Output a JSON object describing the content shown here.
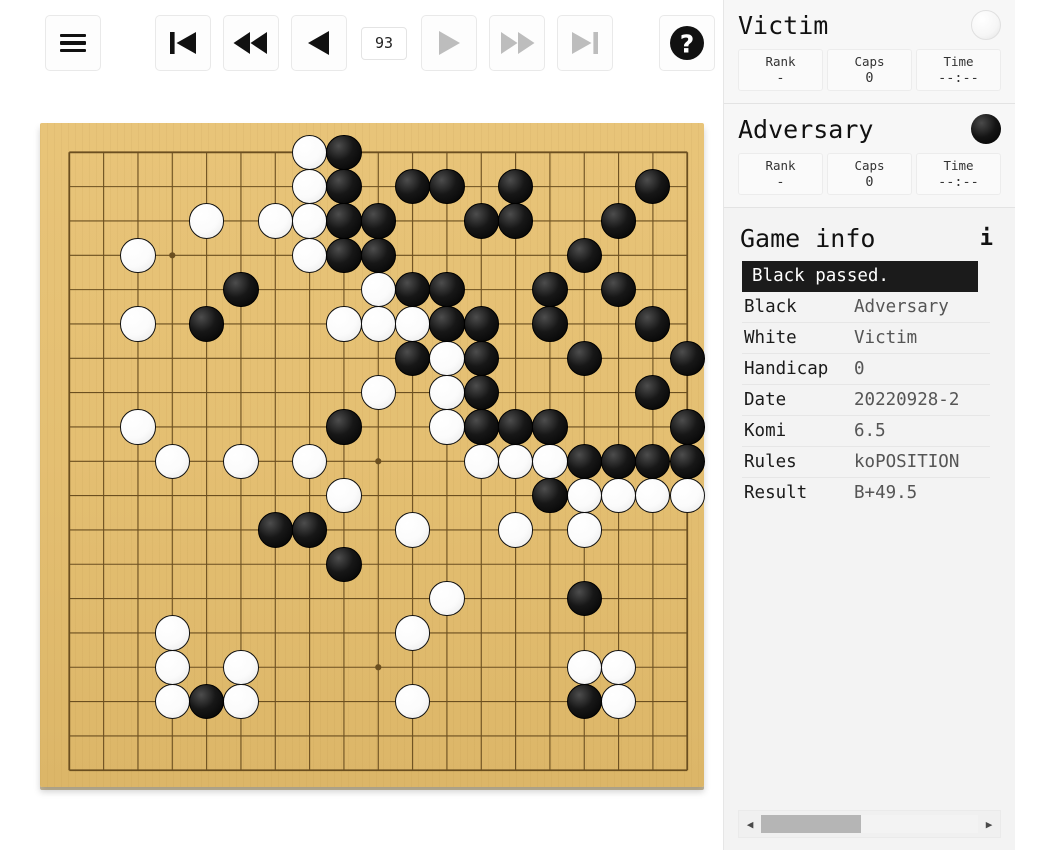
{
  "toolbar": {
    "menu_label": "menu-icon",
    "first_label": "first-move",
    "back10_label": "back-ten-moves",
    "back_label": "previous-move",
    "move_number": "93",
    "forward_label": "next-move",
    "forward10_label": "forward-ten-moves",
    "last_label": "last-move",
    "help_label": "help"
  },
  "players": [
    {
      "name": "Victim",
      "color": "white",
      "stats": [
        {
          "key": "Rank",
          "value": "-"
        },
        {
          "key": "Caps",
          "value": "0"
        },
        {
          "key": "Time",
          "value": "--:--"
        }
      ]
    },
    {
      "name": "Adversary",
      "color": "black",
      "stats": [
        {
          "key": "Rank",
          "value": "-"
        },
        {
          "key": "Caps",
          "value": "0"
        },
        {
          "key": "Time",
          "value": "--:--"
        }
      ]
    }
  ],
  "game_info": {
    "title": "Game info",
    "info_icon": "i",
    "banner": "Black passed.",
    "rows": [
      {
        "key": "Black",
        "value": "Adversary"
      },
      {
        "key": "White",
        "value": "Victim"
      },
      {
        "key": "Handicap",
        "value": "0"
      },
      {
        "key": "Date",
        "value": "20220928-2"
      },
      {
        "key": "Komi",
        "value": "6.5"
      },
      {
        "key": "Rules",
        "value": "koPOSITION"
      },
      {
        "key": "Result",
        "value": "B+49.5"
      }
    ]
  },
  "scrollbar": {
    "left_arrow": "◀",
    "right_arrow": "▶"
  },
  "board": {
    "size": 19,
    "colors": {
      "wood": "#e4bf72",
      "line": "#6b4f20",
      "black_stone": "#000000",
      "white_stone": "#ffffff"
    },
    "star_points": [
      [
        3,
        3
      ],
      [
        9,
        3
      ],
      [
        15,
        3
      ],
      [
        3,
        9
      ],
      [
        9,
        9
      ],
      [
        15,
        9
      ],
      [
        3,
        15
      ],
      [
        9,
        15
      ],
      [
        15,
        15
      ]
    ],
    "black_stones": [
      [
        8,
        0
      ],
      [
        8,
        1
      ],
      [
        10,
        1
      ],
      [
        11,
        1
      ],
      [
        13,
        1
      ],
      [
        17,
        1
      ],
      [
        8,
        2
      ],
      [
        9,
        2
      ],
      [
        12,
        2
      ],
      [
        13,
        2
      ],
      [
        16,
        2
      ],
      [
        8,
        3
      ],
      [
        9,
        3
      ],
      [
        15,
        3
      ],
      [
        5,
        4
      ],
      [
        10,
        4
      ],
      [
        11,
        4
      ],
      [
        14,
        4
      ],
      [
        16,
        4
      ],
      [
        4,
        5
      ],
      [
        11,
        5
      ],
      [
        12,
        5
      ],
      [
        14,
        5
      ],
      [
        17,
        5
      ],
      [
        10,
        6
      ],
      [
        12,
        6
      ],
      [
        15,
        6
      ],
      [
        18,
        6
      ],
      [
        12,
        7
      ],
      [
        17,
        7
      ],
      [
        8,
        8
      ],
      [
        12,
        8
      ],
      [
        13,
        8
      ],
      [
        14,
        8
      ],
      [
        18,
        8
      ],
      [
        15,
        9
      ],
      [
        16,
        9
      ],
      [
        17,
        9
      ],
      [
        18,
        9
      ],
      [
        14,
        10
      ],
      [
        6,
        11
      ],
      [
        7,
        11
      ],
      [
        8,
        12
      ],
      [
        15,
        13
      ],
      [
        4,
        16
      ],
      [
        15,
        16
      ]
    ],
    "white_stones": [
      [
        7,
        0
      ],
      [
        7,
        1
      ],
      [
        4,
        2
      ],
      [
        6,
        2
      ],
      [
        7,
        2
      ],
      [
        2,
        3
      ],
      [
        7,
        3
      ],
      [
        9,
        4
      ],
      [
        2,
        5
      ],
      [
        8,
        5
      ],
      [
        9,
        5
      ],
      [
        10,
        5
      ],
      [
        11,
        6
      ],
      [
        9,
        7
      ],
      [
        11,
        7
      ],
      [
        2,
        8
      ],
      [
        11,
        8
      ],
      [
        3,
        9
      ],
      [
        5,
        9
      ],
      [
        7,
        9
      ],
      [
        12,
        9
      ],
      [
        13,
        9
      ],
      [
        14,
        9
      ],
      [
        8,
        10
      ],
      [
        15,
        10
      ],
      [
        16,
        10
      ],
      [
        17,
        10
      ],
      [
        18,
        10
      ],
      [
        10,
        11
      ],
      [
        13,
        11
      ],
      [
        15,
        11
      ],
      [
        11,
        13
      ],
      [
        3,
        14
      ],
      [
        10,
        14
      ],
      [
        3,
        15
      ],
      [
        5,
        15
      ],
      [
        15,
        15
      ],
      [
        16,
        15
      ],
      [
        3,
        16
      ],
      [
        5,
        16
      ],
      [
        10,
        16
      ],
      [
        16,
        16
      ]
    ]
  }
}
